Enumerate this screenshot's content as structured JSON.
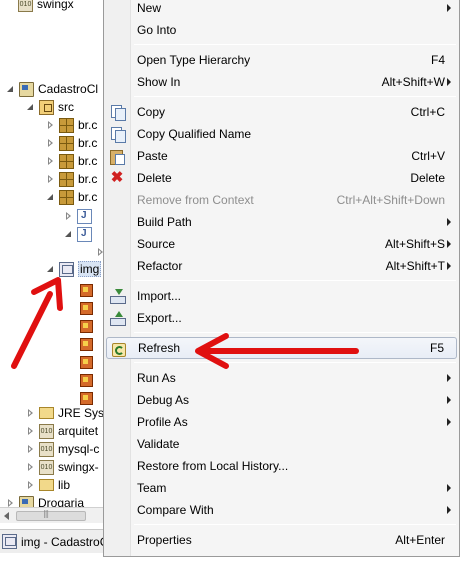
{
  "tree": {
    "items": [
      {
        "label": "swingx"
      },
      {
        "label": "CadastroCl"
      },
      {
        "label": "src"
      },
      {
        "label": "br.c"
      },
      {
        "label": "br.c"
      },
      {
        "label": "br.c"
      },
      {
        "label": "br.c"
      },
      {
        "label": "br.c"
      },
      {
        "label": "img"
      },
      {
        "label": "JRE Syst"
      },
      {
        "label": "arquitet"
      },
      {
        "label": "mysql-c"
      },
      {
        "label": "swingx-"
      },
      {
        "label": "lib"
      },
      {
        "label": "Drogaria"
      }
    ]
  },
  "statusbar": {
    "text": "img - CadastroC"
  },
  "menu": {
    "new": {
      "label": "New"
    },
    "go_into": {
      "label": "Go Into"
    },
    "open_type_hierarchy": {
      "label": "Open Type Hierarchy",
      "accel": "F4"
    },
    "show_in": {
      "label": "Show In",
      "accel": "Alt+Shift+W"
    },
    "copy": {
      "label": "Copy",
      "accel": "Ctrl+C"
    },
    "copy_qualified_name": {
      "label": "Copy Qualified Name"
    },
    "paste": {
      "label": "Paste",
      "accel": "Ctrl+V"
    },
    "delete": {
      "label": "Delete",
      "accel": "Delete"
    },
    "remove_from_context": {
      "label": "Remove from Context",
      "accel": "Ctrl+Alt+Shift+Down"
    },
    "build_path": {
      "label": "Build Path"
    },
    "source": {
      "label": "Source",
      "accel": "Alt+Shift+S"
    },
    "refactor": {
      "label": "Refactor",
      "accel": "Alt+Shift+T"
    },
    "import": {
      "label": "Import..."
    },
    "export": {
      "label": "Export..."
    },
    "refresh": {
      "label": "Refresh",
      "accel": "F5"
    },
    "run_as": {
      "label": "Run As"
    },
    "debug_as": {
      "label": "Debug As"
    },
    "profile_as": {
      "label": "Profile As"
    },
    "validate": {
      "label": "Validate"
    },
    "restore_local_history": {
      "label": "Restore from Local History..."
    },
    "team": {
      "label": "Team"
    },
    "compare_with": {
      "label": "Compare With"
    },
    "properties": {
      "label": "Properties",
      "accel": "Alt+Enter"
    }
  },
  "colors": {
    "annotation_arrow": "#e01010",
    "menu_background": "#f5f5f5",
    "disabled_text": "#8e8e8e"
  }
}
